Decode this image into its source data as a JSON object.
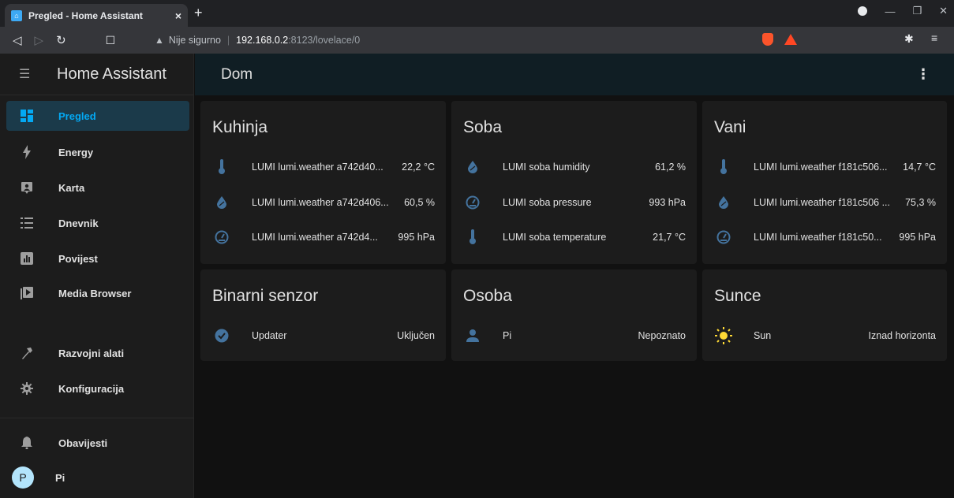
{
  "browser": {
    "tab_title": "Pregled - Home Assistant",
    "tab_close": "×",
    "new_tab": "+",
    "security_label": "Nije sigurno",
    "url_host": "192.168.0.2",
    "url_port_path": ":8123/lovelace/0"
  },
  "sidebar": {
    "title": "Home Assistant",
    "items": [
      {
        "label": "Pregled",
        "icon": "dashboard-icon"
      },
      {
        "label": "Energy",
        "icon": "lightning-icon"
      },
      {
        "label": "Karta",
        "icon": "map-icon"
      },
      {
        "label": "Dnevnik",
        "icon": "logbook-icon"
      },
      {
        "label": "Povijest",
        "icon": "history-chart-icon"
      },
      {
        "label": "Media Browser",
        "icon": "media-play-icon"
      },
      {
        "label": "Razvojni alati",
        "icon": "hammer-icon"
      },
      {
        "label": "Konfiguracija",
        "icon": "gear-icon"
      },
      {
        "label": "Obavijesti",
        "icon": "bell-icon"
      },
      {
        "label": "Pi",
        "icon": "avatar",
        "avatar_letter": "P"
      }
    ]
  },
  "header": {
    "title": "Dom"
  },
  "cards": {
    "kuhinja": {
      "title": "Kuhinja",
      "rows": [
        {
          "name": "LUMI lumi.weather a742d40...",
          "value": "22,2 °C",
          "icon": "thermometer-icon"
        },
        {
          "name": "LUMI lumi.weather a742d406...",
          "value": "60,5 %",
          "icon": "water-percent-icon"
        },
        {
          "name": "LUMI lumi.weather a742d4...",
          "value": "995 hPa",
          "icon": "gauge-icon"
        }
      ]
    },
    "soba": {
      "title": "Soba",
      "rows": [
        {
          "name": "LUMI soba humidity",
          "value": "61,2 %",
          "icon": "water-percent-icon"
        },
        {
          "name": "LUMI soba pressure",
          "value": "993 hPa",
          "icon": "gauge-icon"
        },
        {
          "name": "LUMI soba temperature",
          "value": "21,7 °C",
          "icon": "thermometer-icon"
        }
      ]
    },
    "vani": {
      "title": "Vani",
      "rows": [
        {
          "name": "LUMI lumi.weather f181c506...",
          "value": "14,7 °C",
          "icon": "thermometer-icon"
        },
        {
          "name": "LUMI lumi.weather f181c506 ...",
          "value": "75,3 %",
          "icon": "water-percent-icon"
        },
        {
          "name": "LUMI lumi.weather f181c50...",
          "value": "995 hPa",
          "icon": "gauge-icon"
        }
      ]
    },
    "binarni": {
      "title": "Binarni senzor",
      "rows": [
        {
          "name": "Updater",
          "value": "Uključen",
          "icon": "check-circle-icon"
        }
      ]
    },
    "osoba": {
      "title": "Osoba",
      "rows": [
        {
          "name": "Pi",
          "value": "Nepoznato",
          "icon": "person-icon"
        }
      ]
    },
    "sunce": {
      "title": "Sunce",
      "rows": [
        {
          "name": "Sun",
          "value": "Iznad horizonta",
          "icon": "sun-icon"
        }
      ]
    }
  },
  "colors": {
    "accent": "#03a9f4",
    "icon_blue": "#44739e",
    "sun_yellow": "#fdd835"
  }
}
